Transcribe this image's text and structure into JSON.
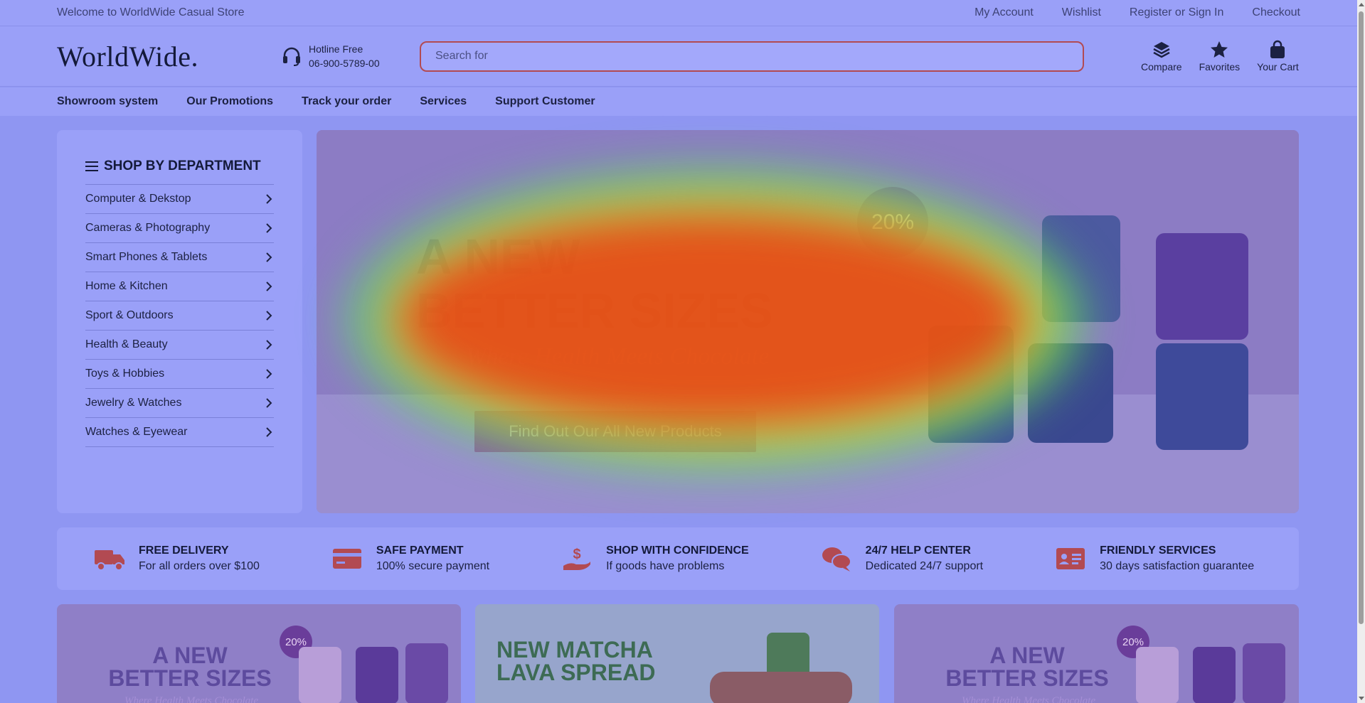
{
  "topbar": {
    "welcome": "Welcome to WorldWide Casual Store",
    "links": [
      "My Account",
      "Wishlist",
      "Register or Sign In",
      "Checkout"
    ]
  },
  "header": {
    "logo": "WorldWide.",
    "hotline_label": "Hotline Free",
    "hotline_number": "06-900-5789-00",
    "search_placeholder": "Search for",
    "icons": [
      {
        "label": "Compare",
        "icon": "layers-icon"
      },
      {
        "label": "Favorites",
        "icon": "star-icon"
      },
      {
        "label": "Your Cart",
        "icon": "bag-icon"
      }
    ]
  },
  "nav": [
    "Showroom system",
    "Our Promotions",
    "Track your order",
    "Services",
    "Support Customer"
  ],
  "sidebar": {
    "title": "SHOP BY DEPARTMENT",
    "items": [
      "Computer & Dekstop",
      "Cameras & Photography",
      "Smart Phones & Tablets",
      "Home & Kitchen",
      "Sport & Outdoors",
      "Health & Beauty",
      "Toys & Hobbies",
      "Jewelry & Watches",
      "Watches & Eyewear"
    ]
  },
  "hero": {
    "badge": "20%",
    "title_line1": "A NEW",
    "title_line2": "BETTER SIZES",
    "subtitle": "Where Health Meets Chocolate",
    "button": "Find Out Our All New Products"
  },
  "features": [
    {
      "title": "FREE DELIVERY",
      "desc": "For all orders over $100",
      "icon": "truck-icon"
    },
    {
      "title": "SAFE PAYMENT",
      "desc": "100% secure payment",
      "icon": "credit-card-icon"
    },
    {
      "title": "SHOP WITH CONFIDENCE",
      "desc": "If goods have problems",
      "icon": "hand-dollar-icon"
    },
    {
      "title": "24/7 HELP CENTER",
      "desc": "Dedicated 24/7 support",
      "icon": "chat-icon"
    },
    {
      "title": "FRIENDLY SERVICES",
      "desc": "30 days satisfaction guarantee",
      "icon": "id-card-icon"
    }
  ],
  "promos": [
    {
      "title_line1": "A NEW",
      "title_line2": "BETTER SIZES",
      "sub": "Where Health Meets Chocolate",
      "badge": "20%"
    },
    {
      "title_line1": "NEW MATCHA",
      "title_line2": "LAVA SPREAD"
    },
    {
      "title_line1": "A NEW",
      "title_line2": "BETTER SIZES",
      "sub": "Where Health Meets Chocolate",
      "badge": "20%"
    }
  ],
  "colors": {
    "accent": "#b24a52",
    "page_bg": "#8f96f2",
    "panel_bg": "#9aa0f8"
  }
}
